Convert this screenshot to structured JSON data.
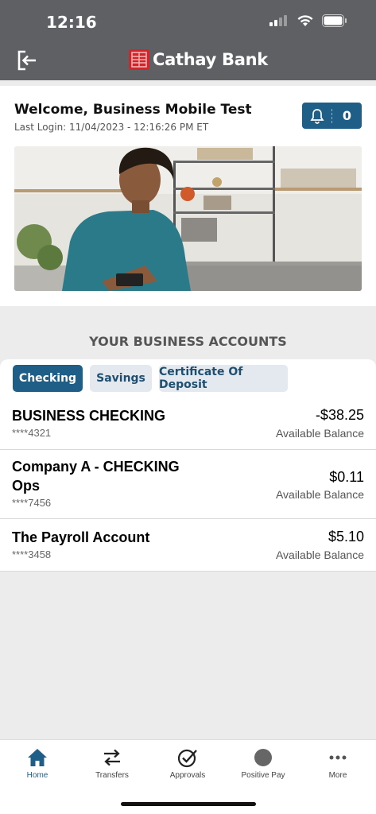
{
  "status_bar": {
    "time": "12:16"
  },
  "header": {
    "brand": "Cathay Bank"
  },
  "welcome": {
    "title": "Welcome, Business Mobile Test",
    "last_login": "Last Login: 11/04/2023 - 12:16:26 PM ET",
    "notification_count": "0"
  },
  "accounts_section": {
    "title": "YOUR BUSINESS ACCOUNTS",
    "tabs": [
      {
        "label": "Checking",
        "active": true
      },
      {
        "label": "Savings",
        "active": false
      },
      {
        "label": "Certificate Of Deposit",
        "active": false
      }
    ],
    "accounts": [
      {
        "name": "BUSINESS CHECKING",
        "number": "****4321",
        "balance": "-$38.25",
        "balance_label": "Available Balance"
      },
      {
        "name": "Company A - CHECKING Ops",
        "name_line1": "Company A - CHECKING",
        "name_line2": "Ops",
        "number": "****7456",
        "balance": "$0.11",
        "balance_label": "Available Balance"
      },
      {
        "name": "The Payroll Account",
        "number": "****3458",
        "balance": "$5.10",
        "balance_label": "Available Balance"
      }
    ]
  },
  "bottom_nav": [
    {
      "label": "Home",
      "icon": "home-icon",
      "active": true
    },
    {
      "label": "Transfers",
      "icon": "transfer-arrows-icon",
      "active": false
    },
    {
      "label": "Approvals",
      "icon": "check-circle-icon",
      "active": false
    },
    {
      "label": "Positive Pay",
      "icon": "circle-icon",
      "active": false
    },
    {
      "label": "More",
      "icon": "more-dots-icon",
      "active": false
    }
  ],
  "colors": {
    "header": "#5e6063",
    "accent": "#1f5e86",
    "brand_red": "#d4242a"
  }
}
